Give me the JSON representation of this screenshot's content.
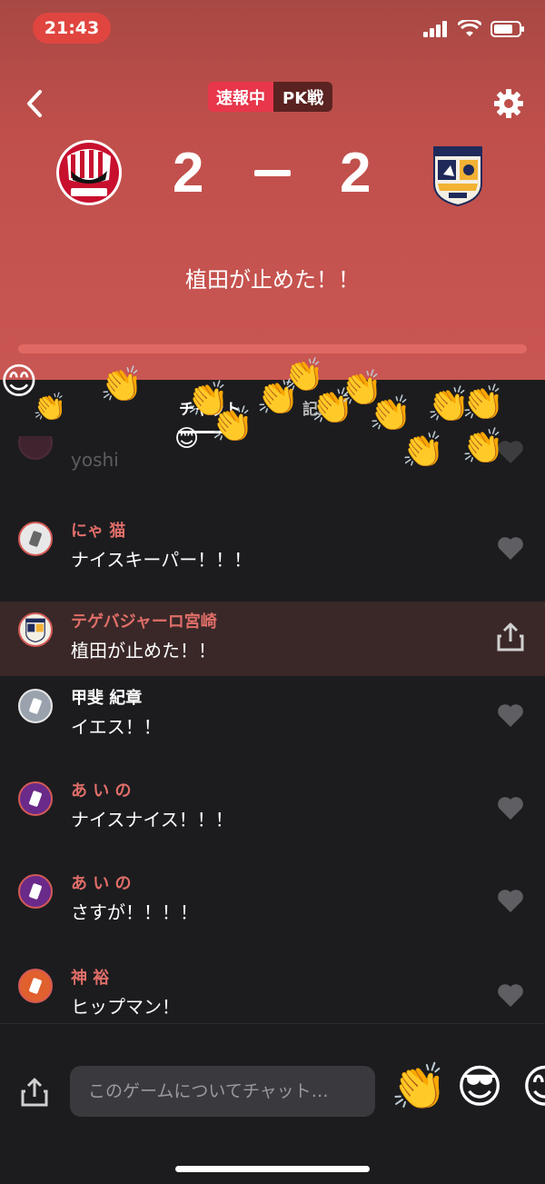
{
  "status": {
    "time": "21:43"
  },
  "match": {
    "badge_live": "速報中",
    "badge_phase": "PK戦",
    "home_score": "2",
    "away_score": "2",
    "headline": "植田が止めた！！"
  },
  "tabs": {
    "chat": "チャット",
    "record": "記録"
  },
  "messages": [
    {
      "name": "",
      "text": "yoshi"
    },
    {
      "name": "にゃ 猫",
      "text": "ナイスキーパー！！！"
    },
    {
      "name": "テゲバジャーロ宮崎",
      "text": "植田が止めた！！"
    },
    {
      "name": "甲斐 紀章",
      "text": "イエス！！"
    },
    {
      "name": "あ い の",
      "text": "ナイスナイス！！！"
    },
    {
      "name": "あ い の",
      "text": "さすが！！！！"
    },
    {
      "name": "神 裕",
      "text": "ヒップマン！"
    }
  ],
  "input": {
    "placeholder": "このゲームについてチャット…"
  },
  "reactions": [
    "👏",
    "😎",
    "😊"
  ],
  "colors": {
    "header": "#c95652",
    "accent": "#e8364b",
    "name_red": "#e06e68",
    "background": "#1c1c1f"
  },
  "icons": [
    "back-chevron-icon",
    "gear-icon",
    "share-icon",
    "heart-icon",
    "signal-icon",
    "wifi-icon",
    "battery-icon"
  ]
}
